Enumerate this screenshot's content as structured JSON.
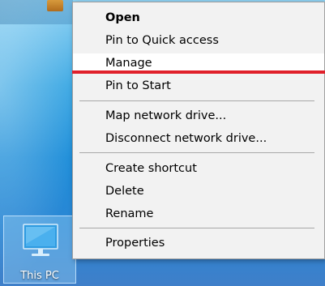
{
  "desktop": {
    "icon_label": "This PC",
    "icon_name": "this-pc-icon"
  },
  "menu": {
    "items": [
      {
        "label": "Open"
      },
      {
        "label": "Pin to Quick access"
      },
      {
        "label": "Manage"
      },
      {
        "label": "Pin to Start"
      },
      {
        "label": "Map network drive..."
      },
      {
        "label": "Disconnect network drive..."
      },
      {
        "label": "Create shortcut"
      },
      {
        "label": "Delete"
      },
      {
        "label": "Rename"
      },
      {
        "label": "Properties"
      }
    ]
  },
  "colors": {
    "menu_background": "#f2f2f2",
    "hover_background": "#ffffff",
    "highlight_underline": "#e0202a",
    "desktop_blue": "#1e8ed9"
  }
}
